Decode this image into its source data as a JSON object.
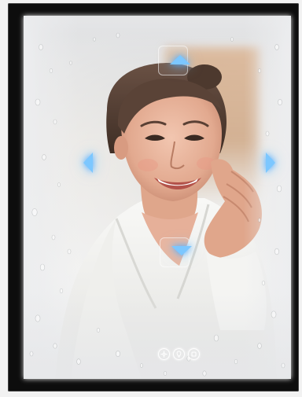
{
  "scene": {
    "subject": "woman-in-white-robe-smiling",
    "accent_color": "#7cc7ff",
    "frame_color": "#0d0d0d"
  },
  "controls": {
    "arrows": [
      {
        "direction": "up",
        "icon": "arrow-up-icon"
      },
      {
        "direction": "left",
        "icon": "arrow-left-icon"
      },
      {
        "direction": "right",
        "icon": "arrow-right-icon"
      },
      {
        "direction": "down",
        "icon": "arrow-down-icon"
      }
    ],
    "touch_buttons": [
      {
        "icon": "defog-icon"
      },
      {
        "icon": "light-icon"
      },
      {
        "icon": "power-icon"
      }
    ]
  }
}
